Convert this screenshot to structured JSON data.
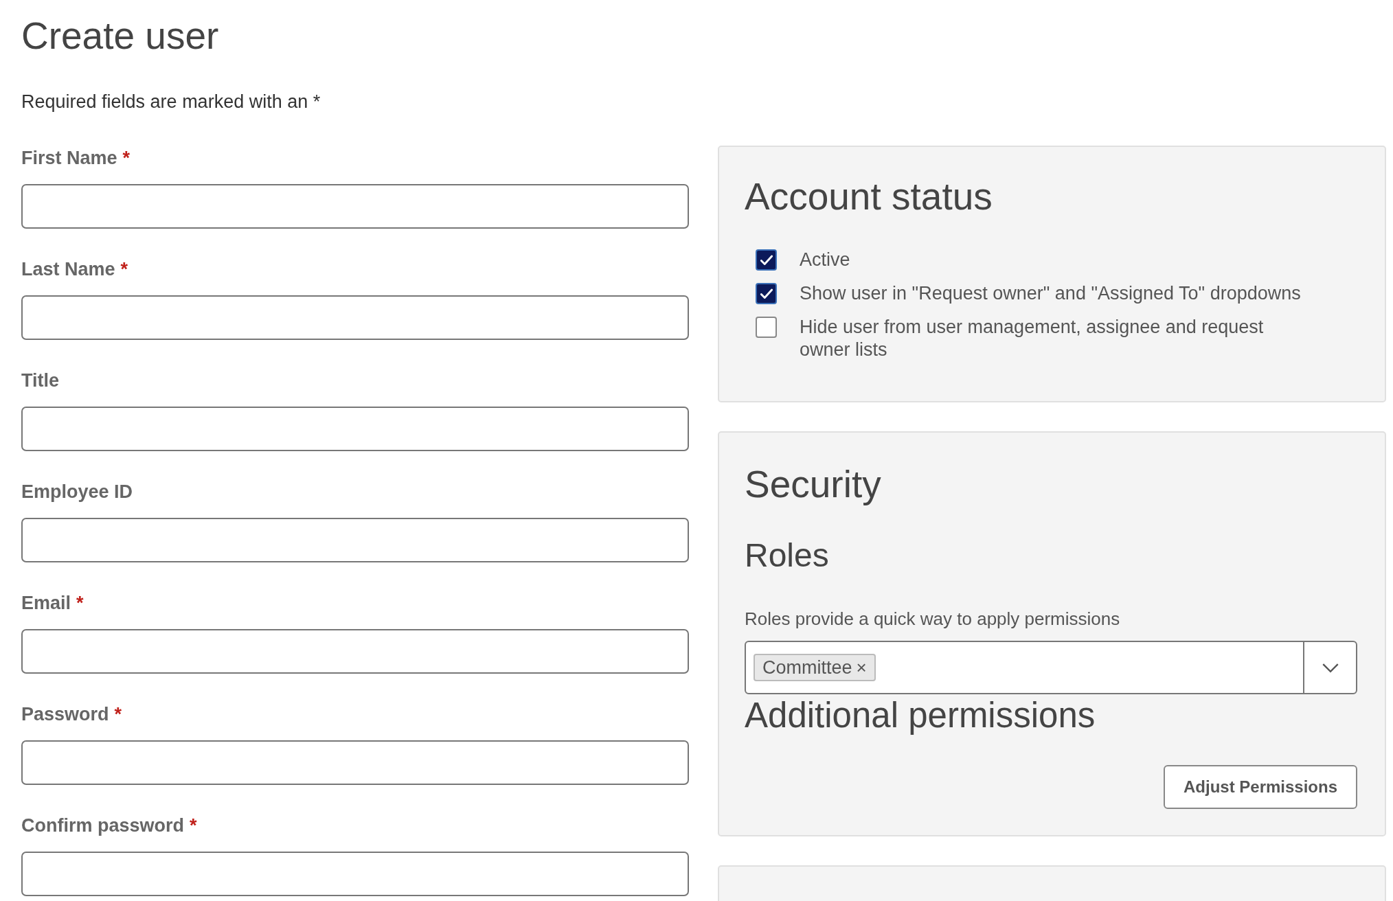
{
  "page": {
    "title": "Create user",
    "intro": "Required fields are marked with an *"
  },
  "fields": [
    {
      "label": "First Name",
      "required_mark": "*"
    },
    {
      "label": "Last Name",
      "required_mark": "*"
    },
    {
      "label": "Title"
    },
    {
      "label": "Employee ID"
    },
    {
      "label": "Email",
      "required_mark": "*"
    },
    {
      "label": "Password",
      "required_mark": "*"
    },
    {
      "label": "Confirm password",
      "required_mark": "*"
    }
  ],
  "account_status": {
    "title": "Account status",
    "options": [
      {
        "label": "Active",
        "checked": true
      },
      {
        "label": "Show user in \"Request owner\" and \"Assigned To\" dropdowns",
        "checked": true
      },
      {
        "label": "Hide user from user management, assignee and request owner lists",
        "checked": false
      }
    ]
  },
  "security": {
    "title": "Security",
    "roles_title": "Roles",
    "roles_help": "Roles provide a quick way to apply permissions",
    "roles": [
      {
        "label": "Committee",
        "remove": "×"
      }
    ],
    "permissions_title": "Additional permissions",
    "permissions_button": "Adjust Permissions"
  }
}
